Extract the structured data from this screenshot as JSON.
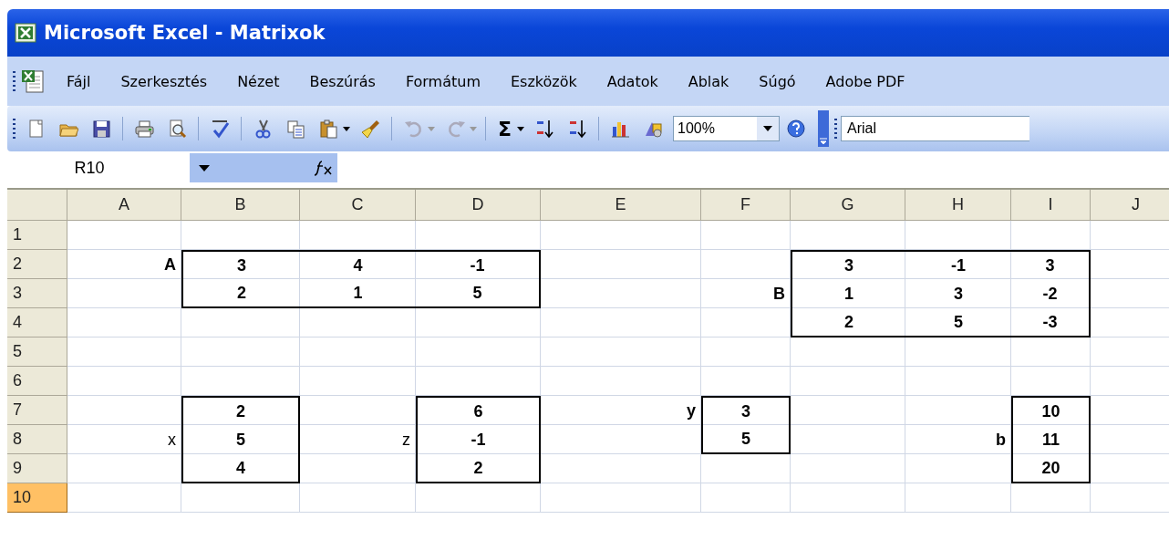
{
  "window": {
    "title": "Microsoft Excel - Matrixok"
  },
  "menu": [
    "Fájl",
    "Szerkesztés",
    "Nézet",
    "Beszúrás",
    "Formátum",
    "Eszközök",
    "Adatok",
    "Ablak",
    "Súgó",
    "Adobe PDF"
  ],
  "toolbar": {
    "sum": "Σ",
    "zoom": "100%",
    "font": "Arial"
  },
  "formula_bar": {
    "name_box": "R10"
  },
  "columns": [
    "A",
    "B",
    "C",
    "D",
    "E",
    "F",
    "G",
    "H",
    "I",
    "J"
  ],
  "rows": [
    {
      "header": "1",
      "selected": false,
      "cells": [
        null,
        null,
        null,
        null,
        null,
        null,
        null,
        null,
        null,
        null
      ]
    },
    {
      "header": "2",
      "selected": false,
      "cells": [
        {
          "text": "A",
          "bold": true,
          "kind": "label"
        },
        {
          "text": "3",
          "bold": true,
          "kind": "value",
          "border_top": true,
          "border_left": true
        },
        {
          "text": "4",
          "bold": true,
          "kind": "value",
          "border_top": true
        },
        {
          "text": "-1",
          "bold": true,
          "kind": "value",
          "border_top": true,
          "border_right": true
        },
        null,
        null,
        {
          "text": "3",
          "bold": true,
          "kind": "value",
          "border_top": true,
          "border_left": true
        },
        {
          "text": "-1",
          "bold": true,
          "kind": "value",
          "border_top": true
        },
        {
          "text": "3",
          "bold": true,
          "kind": "value",
          "border_top": true,
          "border_right": true
        },
        null
      ]
    },
    {
      "header": "3",
      "selected": false,
      "cells": [
        null,
        {
          "text": "2",
          "bold": true,
          "kind": "value",
          "border_bottom": true,
          "border_left": true
        },
        {
          "text": "1",
          "bold": true,
          "kind": "value",
          "border_bottom": true
        },
        {
          "text": "5",
          "bold": true,
          "kind": "value",
          "border_bottom": true,
          "border_right": true
        },
        null,
        {
          "text": "B",
          "bold": true,
          "kind": "label"
        },
        {
          "text": "1",
          "bold": true,
          "kind": "value",
          "border_left": true
        },
        {
          "text": "3",
          "bold": true,
          "kind": "value"
        },
        {
          "text": "-2",
          "bold": true,
          "kind": "value",
          "border_right": true
        },
        null
      ]
    },
    {
      "header": "4",
      "selected": false,
      "cells": [
        null,
        null,
        null,
        null,
        null,
        null,
        {
          "text": "2",
          "bold": true,
          "kind": "value",
          "border_bottom": true,
          "border_left": true
        },
        {
          "text": "5",
          "bold": true,
          "kind": "value",
          "border_bottom": true
        },
        {
          "text": "-3",
          "bold": true,
          "kind": "value",
          "border_bottom": true,
          "border_right": true
        },
        null
      ]
    },
    {
      "header": "5",
      "selected": false,
      "cells": [
        null,
        null,
        null,
        null,
        null,
        null,
        null,
        null,
        null,
        null
      ]
    },
    {
      "header": "6",
      "selected": false,
      "cells": [
        null,
        null,
        null,
        null,
        null,
        null,
        null,
        null,
        null,
        null
      ]
    },
    {
      "header": "7",
      "selected": false,
      "cells": [
        null,
        {
          "text": "2",
          "bold": true,
          "kind": "value",
          "border_top": true,
          "border_left": true,
          "border_right": true
        },
        null,
        {
          "text": "6",
          "bold": true,
          "kind": "value",
          "border_top": true,
          "border_left": true,
          "border_right": true
        },
        {
          "text": "y",
          "bold": true,
          "kind": "label"
        },
        {
          "text": "3",
          "bold": true,
          "kind": "value",
          "border_top": true,
          "border_left": true,
          "border_right": true
        },
        null,
        null,
        {
          "text": "10",
          "bold": true,
          "kind": "value",
          "border_top": true,
          "border_left": true,
          "border_right": true
        },
        null
      ]
    },
    {
      "header": "8",
      "selected": false,
      "cells": [
        {
          "text": "x",
          "bold": false,
          "kind": "label"
        },
        {
          "text": "5",
          "bold": true,
          "kind": "value",
          "border_left": true,
          "border_right": true
        },
        {
          "text": "z",
          "bold": false,
          "kind": "label"
        },
        {
          "text": "-1",
          "bold": true,
          "kind": "value",
          "border_left": true,
          "border_right": true
        },
        null,
        {
          "text": "5",
          "bold": true,
          "kind": "value",
          "border_bottom": true,
          "border_left": true,
          "border_right": true
        },
        null,
        {
          "text": "b",
          "bold": true,
          "kind": "label"
        },
        {
          "text": "11",
          "bold": true,
          "kind": "value",
          "border_left": true,
          "border_right": true
        },
        null
      ]
    },
    {
      "header": "9",
      "selected": false,
      "cells": [
        null,
        {
          "text": "4",
          "bold": true,
          "kind": "value",
          "border_bottom": true,
          "border_left": true,
          "border_right": true
        },
        null,
        {
          "text": "2",
          "bold": true,
          "kind": "value",
          "border_bottom": true,
          "border_left": true,
          "border_right": true
        },
        null,
        null,
        null,
        null,
        {
          "text": "20",
          "bold": true,
          "kind": "value",
          "border_bottom": true,
          "border_left": true,
          "border_right": true
        },
        null
      ]
    },
    {
      "header": "10",
      "selected": true,
      "cells": [
        null,
        null,
        null,
        null,
        null,
        null,
        null,
        null,
        null,
        null
      ]
    }
  ]
}
